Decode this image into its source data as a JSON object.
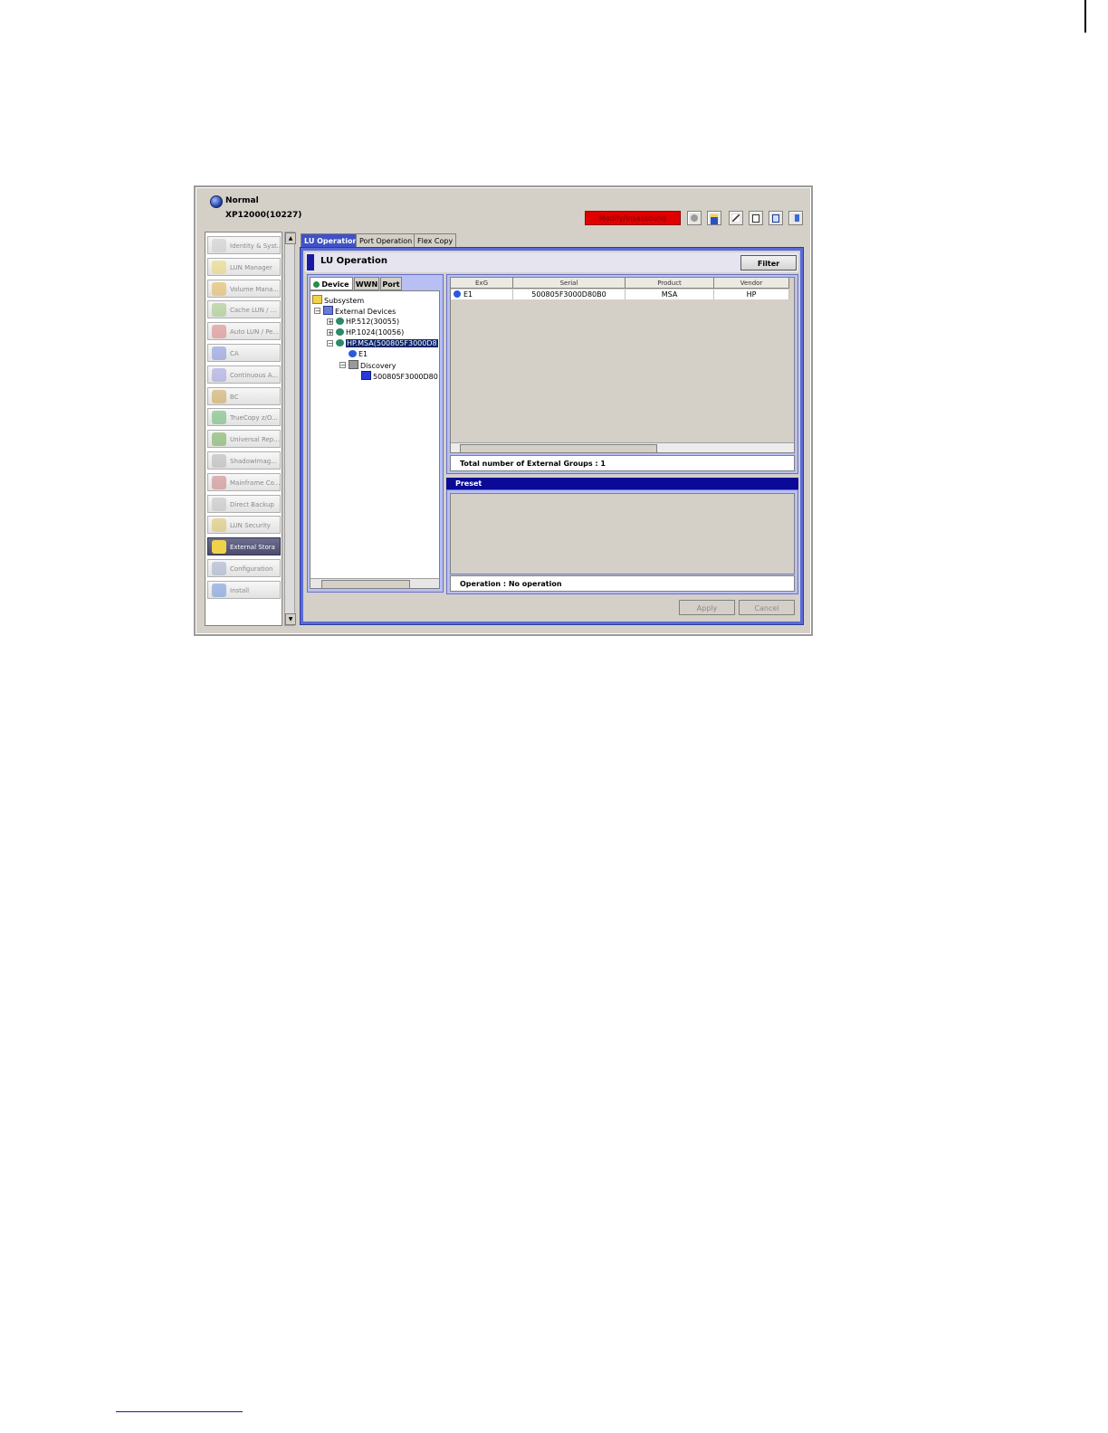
{
  "header": {
    "status": "Normal",
    "system": "XP12000(10227)",
    "mode_label": "Modify/Insassound",
    "toolbar_icons": [
      "refresh-icon",
      "save-icon",
      "pen-icon",
      "preview-icon",
      "report-icon",
      "exit-icon"
    ]
  },
  "sidebar": {
    "items": [
      {
        "label": "Identity & Syst...",
        "icon": "identity-icon",
        "color": "#c9c9c9"
      },
      {
        "label": "LUN Manager",
        "icon": "lun-manager-icon",
        "color": "#e8d36a"
      },
      {
        "label": "Volume Mana...",
        "icon": "volume-icon",
        "color": "#e2b24c"
      },
      {
        "label": "Cache LUN / ...",
        "icon": "cache-icon",
        "color": "#9ac47a"
      },
      {
        "label": "Auto LUN / Pe...",
        "icon": "gauge-icon",
        "color": "#d97a7a"
      },
      {
        "label": "CA",
        "icon": "ca-icon",
        "color": "#7a8dd9"
      },
      {
        "label": "Continuous A...",
        "icon": "continuous-icon",
        "color": "#9a9ae0"
      },
      {
        "label": "BC",
        "icon": "bc-icon",
        "color": "#c9a04a"
      },
      {
        "label": "TrueCopy z/O...",
        "icon": "truecopy-icon",
        "color": "#5fb56a"
      },
      {
        "label": "Universal Rep...",
        "icon": "universal-icon",
        "color": "#6aa84f"
      },
      {
        "label": "ShadowImag...",
        "icon": "shadow-icon",
        "color": "#b0b0b0"
      },
      {
        "label": "Mainframe Co...",
        "icon": "mainframe-icon",
        "color": "#c97a7a"
      },
      {
        "label": "Direct Backup",
        "icon": "backup-icon",
        "color": "#bdbdbd"
      },
      {
        "label": "LUN Security",
        "icon": "lock-icon",
        "color": "#d8c05a"
      },
      {
        "label": "External Stora",
        "icon": "external-storage-icon",
        "color": "#f0d24a",
        "active": true
      },
      {
        "label": "Configuration",
        "icon": "config-icon",
        "color": "#9aa9c9"
      },
      {
        "label": "Install",
        "icon": "install-icon",
        "color": "#6a8fd9"
      }
    ]
  },
  "tabs": [
    {
      "label": "LU Operation",
      "active": true
    },
    {
      "label": "Port Operation",
      "active": false
    },
    {
      "label": "Flex Copy",
      "active": false
    }
  ],
  "panel": {
    "title": "LU Operation",
    "filter_label": "Filter",
    "tree_tabs": [
      {
        "label": "Device",
        "active": true
      },
      {
        "label": "WWN",
        "active": false
      },
      {
        "label": "Port",
        "active": false
      }
    ],
    "tree": [
      {
        "label": "Subsystem",
        "level": 0
      },
      {
        "label": "External Devices",
        "level": 1
      },
      {
        "label": "HP.512(30055)",
        "level": 2
      },
      {
        "label": "HP.1024(10056)",
        "level": 2
      },
      {
        "label": "HP.MSA(500805F3000D8",
        "level": 2,
        "selected": true
      },
      {
        "label": "E1",
        "level": 3
      },
      {
        "label": "Discovery",
        "level": 3
      },
      {
        "label": "500805F3000D80",
        "level": 4
      }
    ],
    "grid": {
      "columns": [
        "ExG",
        "Serial",
        "Product",
        "Vendor"
      ],
      "rows": [
        [
          "E1",
          "500805F3000D80B0",
          "MSA",
          "HP"
        ]
      ]
    },
    "total_text": "Total number of External Groups : 1",
    "preset_label": "Preset",
    "operation_text": "Operation : No operation",
    "apply_label": "Apply",
    "cancel_label": "Cancel"
  }
}
